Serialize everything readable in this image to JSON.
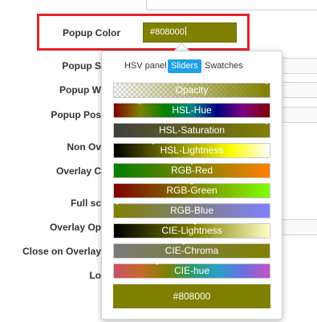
{
  "form": {
    "labels": {
      "popup_color": "Popup Color",
      "popup_s": "Popup S",
      "popup_w": "Popup W",
      "popup_pos": "Popup Pos",
      "non_ov": "Non Ov",
      "overlay_c": "Overlay C",
      "full_sc": "Full sc",
      "overlay_op": "Overlay Op",
      "close_on_overlay": "Close on Overlay",
      "lo": "Lo"
    },
    "popup_color_value": "#808000"
  },
  "picker": {
    "tabs": [
      {
        "label": "HSV panel",
        "active": false
      },
      {
        "label": "Sliders",
        "active": true
      },
      {
        "label": "Swatches",
        "active": false
      }
    ],
    "sliders": [
      {
        "name": "opacity-slider",
        "label": "Opacity",
        "value_fraction": 1.0
      },
      {
        "name": "hsl-hue-slider",
        "label": "HSL-Hue",
        "value_fraction": 0.167
      },
      {
        "name": "hsl-saturation-slider",
        "label": "HSL-Saturation",
        "value_fraction": 1.0
      },
      {
        "name": "hsl-lightness-slider",
        "label": "HSL-Lightness",
        "value_fraction": 0.25
      },
      {
        "name": "rgb-red-slider",
        "label": "RGB-Red",
        "value_fraction": 0.502
      },
      {
        "name": "rgb-green-slider",
        "label": "RGB-Green",
        "value_fraction": 0.502
      },
      {
        "name": "rgb-blue-slider",
        "label": "RGB-Blue",
        "value_fraction": 0.0
      },
      {
        "name": "cie-lightness-slider",
        "label": "CIE-Lightness",
        "value_fraction": 0.52
      },
      {
        "name": "cie-chroma-slider",
        "label": "CIE-Chroma",
        "value_fraction": 0.45
      },
      {
        "name": "cie-hue-slider",
        "label": "CIE-hue",
        "value_fraction": 0.28
      }
    ],
    "current_color_label": "#808000"
  },
  "colors": {
    "current": "#808000",
    "highlight_border": "#e3242b",
    "active_tab": "#1ea1e6"
  }
}
